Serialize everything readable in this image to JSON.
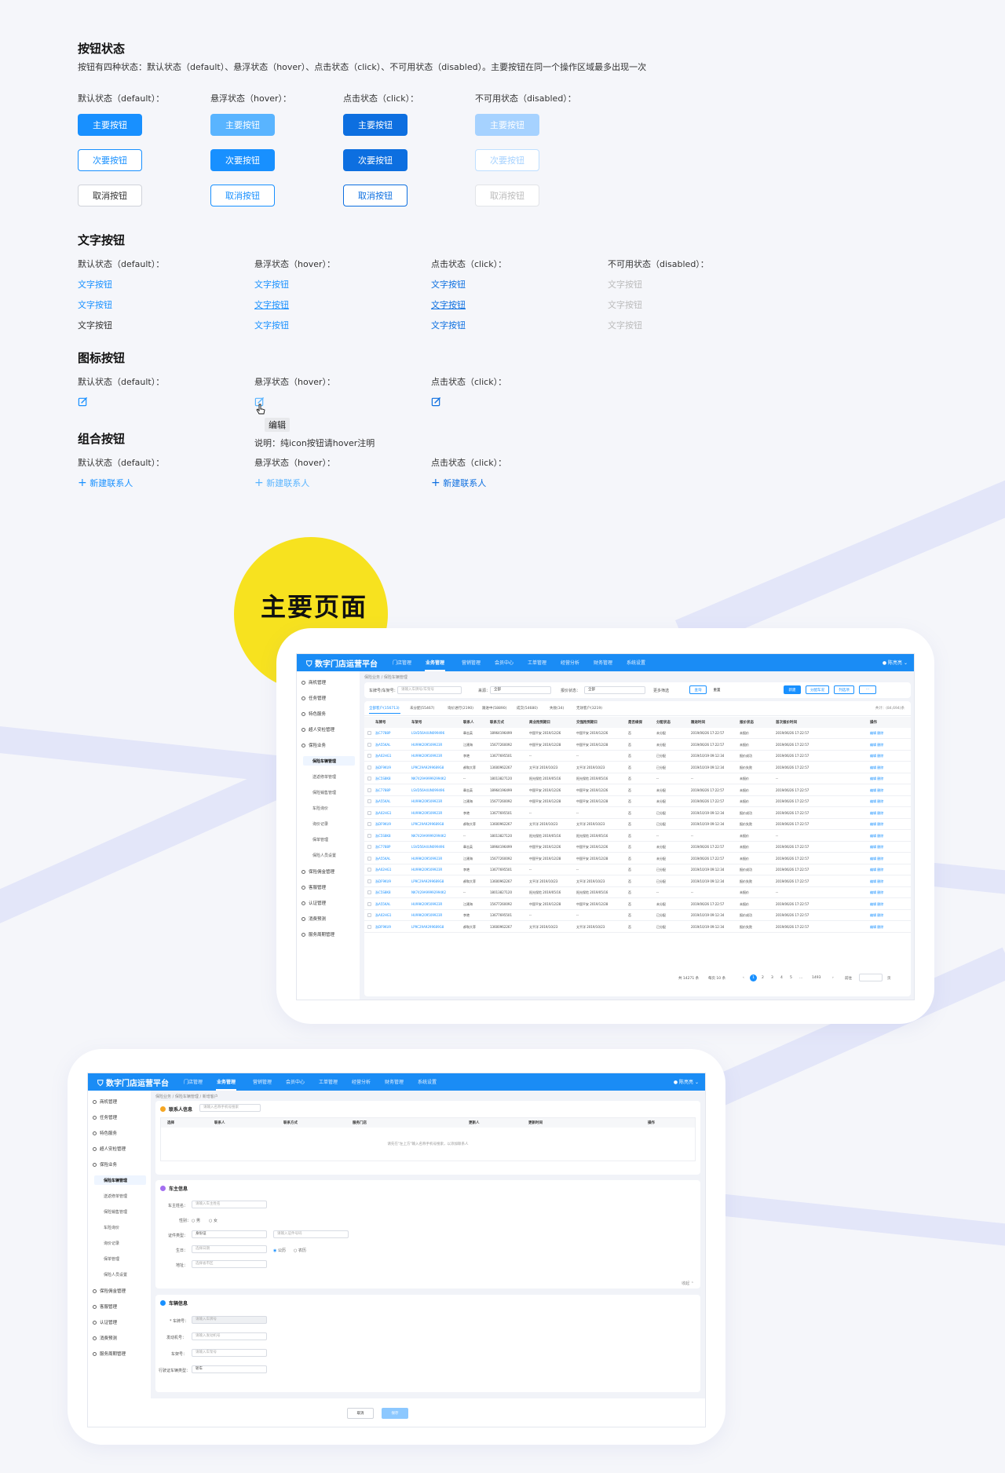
{
  "sections": {
    "buttons": {
      "title": "按钮状态",
      "desc": "按钮有四种状态：默认状态（default）、悬浮状态（hover）、点击状态（click）、不可用状态（disabled）。主要按钮在同一个操作区域最多出现一次",
      "states": [
        "默认状态（default）：",
        "悬浮状态（hover）：",
        "点击状态（click）：",
        "不可用状态（disabled）："
      ],
      "primary": "主要按钮",
      "secondary": "次要按钮",
      "cancel": "取消按钮"
    },
    "text_buttons": {
      "title": "文字按钮",
      "states": [
        "默认状态（default）：",
        "悬浮状态（hover）：",
        "点击状态（click）：",
        "不可用状态（disabled）："
      ],
      "label": "文字按钮"
    },
    "icon_buttons": {
      "title": "图标按钮",
      "states": [
        "默认状态（default）：",
        "悬浮状态（hover）：",
        "点击状态（click）："
      ],
      "tooltip": "编辑",
      "note": "说明：纯icon按钮请hover注明"
    },
    "combo_buttons": {
      "title": "组合按钮",
      "states": [
        "默认状态（default）：",
        "悬浮状态（hover）：",
        "点击状态（click）："
      ],
      "label": "新建联系人"
    }
  },
  "main_pages_title": "主要页面",
  "colors": {
    "primary": "#1890ff",
    "hover": "#59b4ff",
    "click": "#0d6fe0",
    "disabled": "#a6d2ff",
    "badge": "#f7e21f"
  },
  "app": {
    "brand": "数字门店运营平台",
    "nav": [
      "门店管理",
      "业务管理",
      "营销管理",
      "会员中心",
      "工单管理",
      "经营分析",
      "财务管理",
      "系统设置"
    ],
    "user": "陈亮亮",
    "sidebar": [
      "商机管理",
      "任务管理",
      "特色服务",
      "超人安检管理",
      "保险业务"
    ],
    "sidebar_sub": [
      "保险车辆管理",
      "送返修单管理",
      "保险销售管理",
      "车险询价",
      "询价记录",
      "保单管理",
      "保险人员设置"
    ],
    "sidebar_more": [
      "保险佣金管理",
      "客服管理",
      "认证管理",
      "消费预测",
      "服务周期管理"
    ]
  },
  "list_page": {
    "breadcrumb": "保险业务 / 保险车辆管理",
    "filters": {
      "plate_label": "车牌号/车架号：",
      "plate_ph": "请输入车牌号/车架号",
      "src_label": "来源：",
      "src_val": "全部",
      "state_label": "报价状态：",
      "state_val": "全部",
      "more": "更多筛选"
    },
    "buttons": {
      "query": "查询",
      "reset": "重置",
      "new": "新建",
      "assign": "分配车况",
      "export": "列选项",
      "more": "···"
    },
    "tabs": [
      "全部客户(156713)",
      "未分配(55467)",
      "询价进行(2190)",
      "跟进中(58890)",
      "成交(54680)",
      "失败(34)",
      "无效客户(3219)"
    ],
    "total": "共计：(84,694)条",
    "columns": [
      "车牌号",
      "车架号",
      "联系人",
      "联系方式",
      "商业险到期日",
      "交强险到期日",
      "是否续保",
      "分配状态",
      "跟进时间",
      "报价状态",
      "首次报价时间",
      "操作"
    ],
    "rows": [
      [
        "浙C7788P",
        "LSVD56A4UN099496",
        "章志英",
        "18964196499",
        "中国平安 2019/12/26",
        "中国平安 2019/12/26",
        "否",
        "未分配",
        "2019/06/26 17:22:57",
        "未报价",
        "2019/06/26 17:22:57",
        "编辑 删除"
      ],
      [
        "浙A55KAL",
        "HU99K209509923R",
        "江建海",
        "15677260092",
        "中国平安 2019/12/28",
        "中国平安 2019/12/28",
        "否",
        "未分配",
        "2019/06/26 17:22:57",
        "未报价",
        "2019/06/26 17:22:57",
        "编辑 删除"
      ],
      [
        "浙A02HG1",
        "HU99K209509923R",
        "李艳",
        "13677695501",
        "--",
        "--",
        "否",
        "已分配",
        "2019/10/19 09:12:34",
        "报价成功",
        "2019/06/26 17:22:57",
        "编辑 删除"
      ],
      [
        "浙DF9KU9",
        "LP9C29A9299689G8",
        "郝和大菲",
        "13600962267",
        "太平洋 2019/10/23",
        "太平洋 2019/10/23",
        "否",
        "已分配",
        "2019/10/19 09:12:34",
        "报价失败",
        "2019/06/26 17:22:57",
        "编辑 删除"
      ],
      [
        "浙C5S8K8",
        "NK7429A99992994K2",
        "--",
        "18013827120",
        "阳光保险 2019/05/16",
        "阳光保险 2019/05/16",
        "否",
        "--",
        "--",
        "未报价",
        "--",
        "编辑 删除"
      ],
      [
        "浙C7788P",
        "LSVD56A4UN099496",
        "章志英",
        "18964196499",
        "中国平安 2019/12/26",
        "中国平安 2019/12/26",
        "否",
        "未分配",
        "2019/06/26 17:22:57",
        "未报价",
        "2019/06/26 17:22:57",
        "编辑 删除"
      ],
      [
        "浙A55KAL",
        "HU99K209509923R",
        "江建海",
        "15677260092",
        "中国平安 2019/12/28",
        "中国平安 2019/12/28",
        "否",
        "未分配",
        "2019/06/26 17:22:57",
        "未报价",
        "2019/06/26 17:22:57",
        "编辑 删除"
      ],
      [
        "浙A02HG1",
        "HU99K209509923R",
        "李艳",
        "13677695501",
        "--",
        "--",
        "否",
        "已分配",
        "2019/10/19 09:12:34",
        "报价成功",
        "2019/06/26 17:22:57",
        "编辑 删除"
      ],
      [
        "浙DF9KU9",
        "LP9C29A9299689G8",
        "郝和大菲",
        "13600962267",
        "太平洋 2019/10/23",
        "太平洋 2019/10/23",
        "否",
        "已分配",
        "2019/10/19 09:12:34",
        "报价失败",
        "2019/06/26 17:22:57",
        "编辑 删除"
      ],
      [
        "浙C5S8K8",
        "NK7429A99992994K2",
        "--",
        "18013827120",
        "阳光保险 2019/05/16",
        "阳光保险 2019/05/16",
        "否",
        "--",
        "--",
        "未报价",
        "--",
        "编辑 删除"
      ],
      [
        "浙C7788P",
        "LSVD56A4UN099496",
        "章志英",
        "18964196499",
        "中国平安 2019/12/26",
        "中国平安 2019/12/26",
        "否",
        "未分配",
        "2019/06/26 17:22:57",
        "未报价",
        "2019/06/26 17:22:57",
        "编辑 删除"
      ],
      [
        "浙A55KAL",
        "HU99K209509923R",
        "江建海",
        "15677260092",
        "中国平安 2019/12/28",
        "中国平安 2019/12/28",
        "否",
        "未分配",
        "2019/06/26 17:22:57",
        "未报价",
        "2019/06/26 17:22:57",
        "编辑 删除"
      ],
      [
        "浙A02HG1",
        "HU99K209509923R",
        "李艳",
        "13677695501",
        "--",
        "--",
        "否",
        "已分配",
        "2019/10/19 09:12:34",
        "报价成功",
        "2019/06/26 17:22:57",
        "编辑 删除"
      ],
      [
        "浙DF9KU9",
        "LP9C29A9299689G8",
        "郝和大菲",
        "13600962267",
        "太平洋 2019/10/23",
        "太平洋 2019/10/23",
        "否",
        "已分配",
        "2019/10/19 09:12:34",
        "报价失败",
        "2019/06/26 17:22:57",
        "编辑 删除"
      ],
      [
        "浙C5S8K8",
        "NK7429A99992994K2",
        "--",
        "18013827120",
        "阳光保险 2019/05/16",
        "阳光保险 2019/05/16",
        "否",
        "--",
        "--",
        "未报价",
        "--",
        "编辑 删除"
      ],
      [
        "浙A55KAL",
        "HU99K209509923R",
        "江建海",
        "15677260092",
        "中国平安 2019/12/28",
        "中国平安 2019/12/28",
        "否",
        "未分配",
        "2019/06/26 17:22:57",
        "未报价",
        "2019/06/26 17:22:57",
        "编辑 删除"
      ],
      [
        "浙A02HG1",
        "HU99K209509923R",
        "李艳",
        "13677695501",
        "--",
        "--",
        "否",
        "已分配",
        "2019/10/19 09:12:34",
        "报价成功",
        "2019/06/26 17:22:57",
        "编辑 删除"
      ],
      [
        "浙DF9KU9",
        "LP9C29A9299689G8",
        "郝和大菲",
        "13600962267",
        "太平洋 2019/10/23",
        "太平洋 2019/10/23",
        "否",
        "已分配",
        "2019/10/19 09:12:34",
        "报价失败",
        "2019/06/26 17:22:57",
        "编辑 删除"
      ]
    ],
    "pagination": {
      "total": "共 14271 条",
      "per_page": "每页 10 条",
      "pages": [
        "1",
        "2",
        "3",
        "4",
        "5",
        "...",
        "1493"
      ],
      "jump": "前往",
      "page_unit": "页"
    }
  },
  "form_page": {
    "breadcrumb": "保险业务 / 保险车辆管理 / 新增客户",
    "contact": {
      "title": "联系人信息",
      "search_ph": "请输入名称手机号搜索",
      "columns": [
        "选择",
        "联系人",
        "联系方式",
        "服务门店",
        "更新人",
        "更新时间",
        "操作"
      ],
      "empty": "请先在\"左上方\"输入名称手机号搜索，以添加联系人"
    },
    "owner": {
      "title": "车主信息",
      "name_label": "车主姓名：",
      "name_ph": "请输入车主姓名",
      "gender_label": "性别：",
      "male": "男",
      "female": "女",
      "id_label": "证件类型：",
      "id_val": "身份证",
      "id_ph": "请输入证件号码",
      "phone_label": "生日：",
      "phone_ph": "选择日期",
      "type_label": "地址：",
      "type_ph": "选择省市区",
      "radio1": "公历",
      "radio2": "农历",
      "collapse": "收起"
    },
    "vehicle": {
      "title": "车辆信息",
      "plate_label": "* 车牌号：",
      "plate_ph": "请输入车牌号",
      "engine_label": "发动机号：",
      "engine_ph": "请输入发动机号",
      "vin_label": "车架号：",
      "vin_ph": "请输入车架号",
      "type_label": "行驶证车辆类型：",
      "type_val": "轿车"
    },
    "footer": {
      "cancel": "取消",
      "save": "保存"
    }
  }
}
